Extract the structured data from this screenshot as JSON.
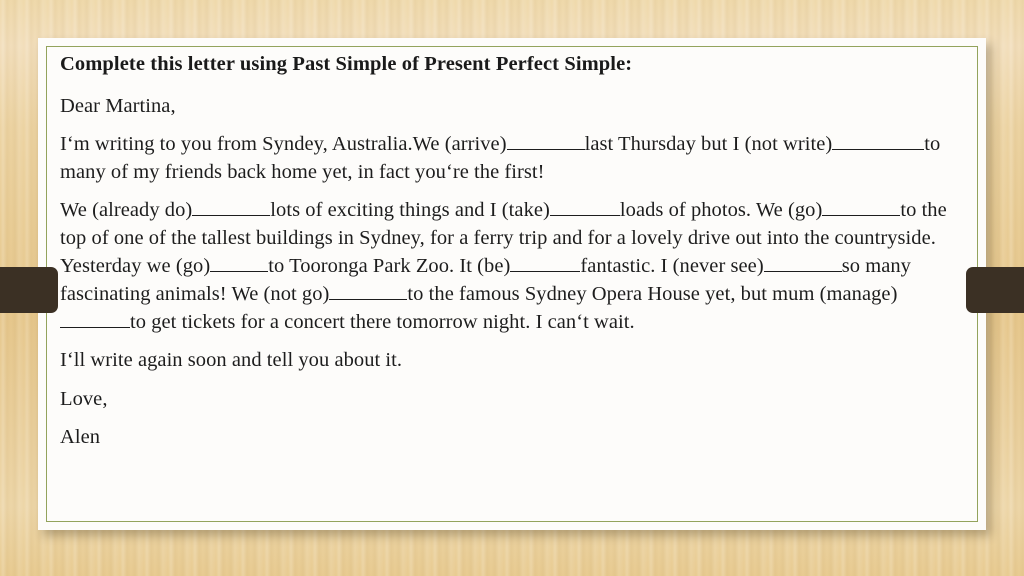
{
  "slide": {
    "heading": "Complete this letter using Past Simple of Present Perfect Simple:",
    "paragraphs": [
      {
        "id": "salutation",
        "segments": [
          {
            "type": "text",
            "value": "Dear Martina,"
          }
        ]
      },
      {
        "id": "body-1",
        "segments": [
          {
            "type": "text",
            "value": "I‘m writing to you from Syndey, Australia.We (arrive)"
          },
          {
            "type": "blank",
            "size": "lg"
          },
          {
            "type": "text",
            "value": "last Thursday but I (not write)"
          },
          {
            "type": "blank",
            "size": "xl"
          },
          {
            "type": "text",
            "value": "to many of my friends back home yet, in fact you‘re the first!"
          }
        ]
      },
      {
        "id": "body-2",
        "segments": [
          {
            "type": "text",
            "value": "We (already do)"
          },
          {
            "type": "blank",
            "size": "lg"
          },
          {
            "type": "text",
            "value": "lots of exciting things and I (take)"
          },
          {
            "type": "blank",
            "size": "md"
          },
          {
            "type": "text",
            "value": "loads of photos. We (go)"
          },
          {
            "type": "blank",
            "size": "lg"
          },
          {
            "type": "text",
            "value": "to the top of one of the tallest buildings in Sydney, for a ferry trip and for a lovely drive out into the countryside. Yesterday we (go)"
          },
          {
            "type": "blank",
            "size": "sm"
          },
          {
            "type": "text",
            "value": "to Tooronga Park Zoo. It (be)"
          },
          {
            "type": "blank",
            "size": "md"
          },
          {
            "type": "text",
            "value": "fantastic. I (never see)"
          },
          {
            "type": "blank",
            "size": "lg"
          },
          {
            "type": "text",
            "value": "so many fascinating animals! We (not go)"
          },
          {
            "type": "blank",
            "size": "lg"
          },
          {
            "type": "text",
            "value": "to the famous Sydney Opera House yet, but mum (manage)"
          },
          {
            "type": "blank",
            "size": "md"
          },
          {
            "type": "text",
            "value": "to get tickets for a concert there tomorrow night. I can‘t wait."
          }
        ]
      },
      {
        "id": "body-3",
        "segments": [
          {
            "type": "text",
            "value": "I‘ll write again soon and tell you about it."
          }
        ]
      },
      {
        "id": "closing",
        "segments": [
          {
            "type": "text",
            "value": "Love,"
          }
        ]
      },
      {
        "id": "signature",
        "segments": [
          {
            "type": "text",
            "value": "Alen"
          }
        ]
      }
    ]
  },
  "colors": {
    "paper": "#fdfcfa",
    "inner_border": "#93a35c",
    "desk_wood": "#e9cd96",
    "overlay_bar": "#3b3024",
    "text": "#1d1d1d"
  }
}
